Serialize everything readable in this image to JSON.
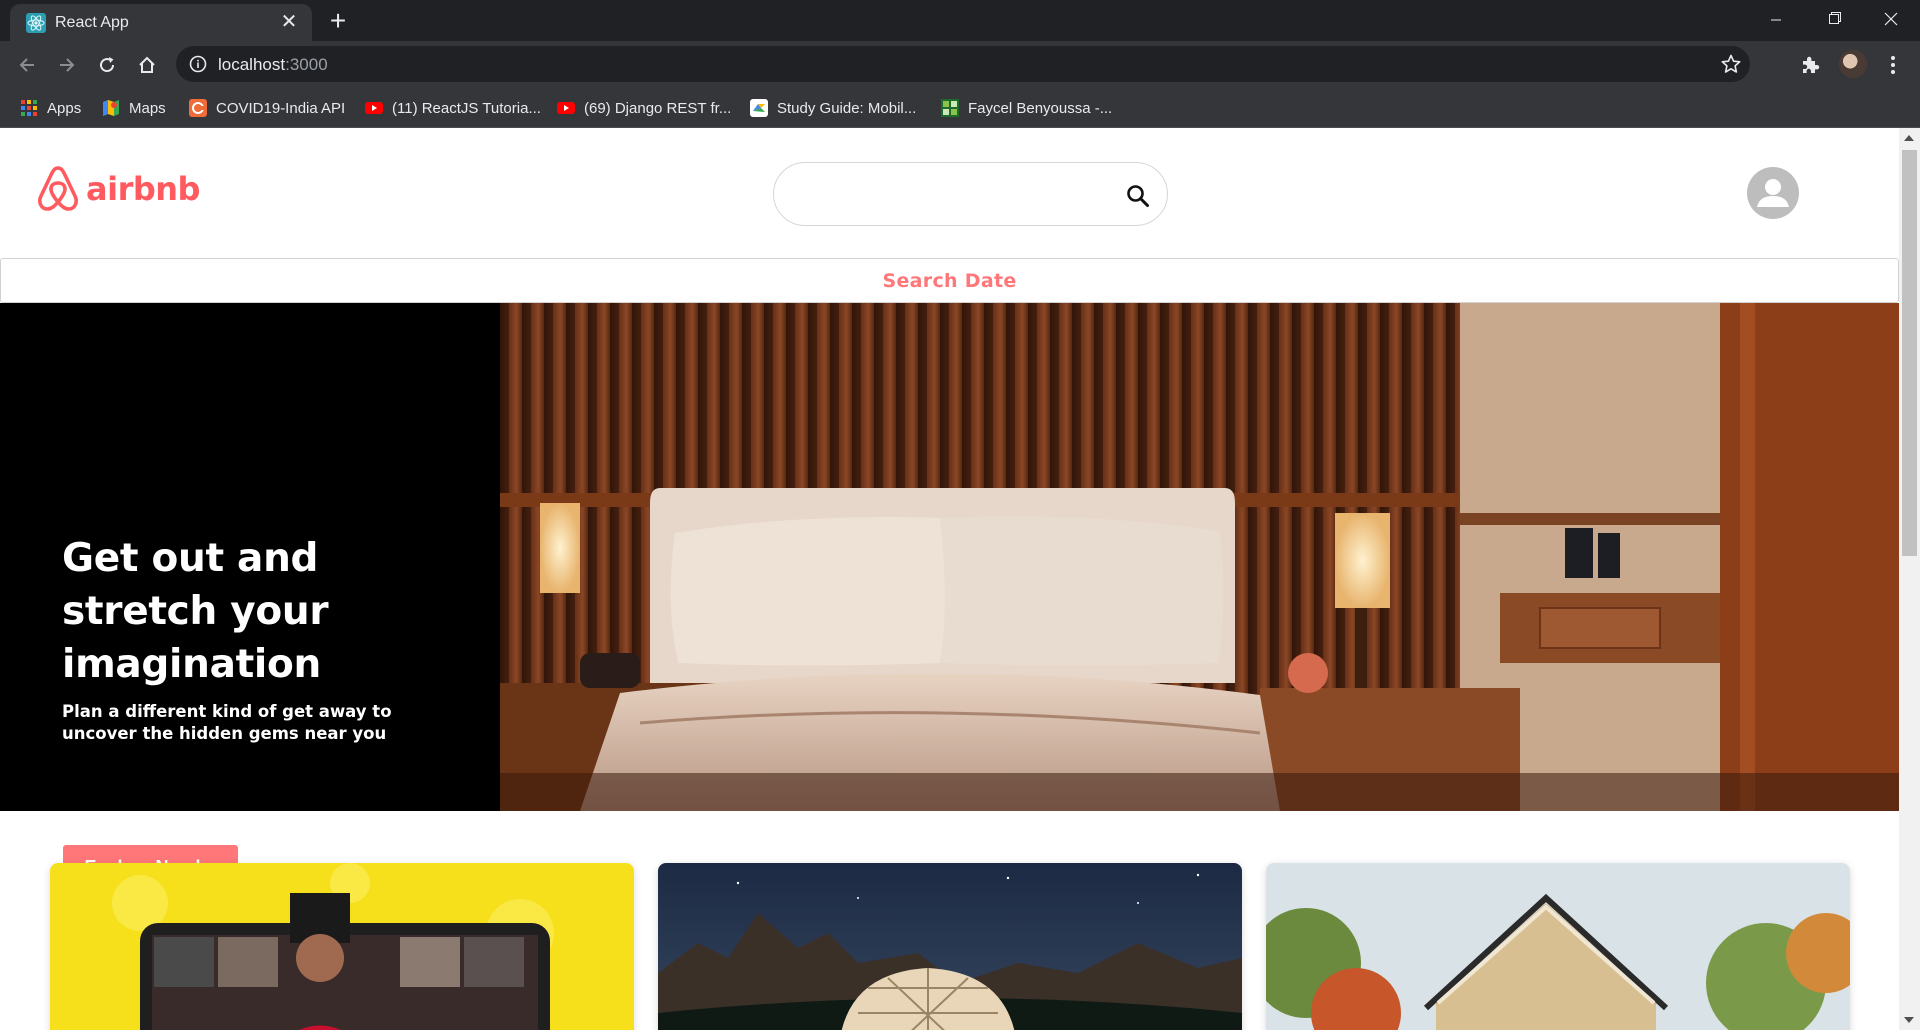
{
  "browser": {
    "tab_title": "React App",
    "url_host": "localhost",
    "url_port": ":3000",
    "bookmarks": [
      {
        "label": "Apps",
        "icon": "apps-grid-icon"
      },
      {
        "label": "Maps",
        "icon": "maps-icon"
      },
      {
        "label": "COVID19-India API",
        "icon": "covid-api-icon"
      },
      {
        "label": "(11) ReactJS Tutoria...",
        "icon": "youtube-icon"
      },
      {
        "label": "(69) Django REST fr...",
        "icon": "youtube-icon"
      },
      {
        "label": "Study Guide: Mobil...",
        "icon": "study-guide-icon"
      },
      {
        "label": "Faycel Benyoussa -...",
        "icon": "profile-site-icon"
      }
    ]
  },
  "header": {
    "logo_text": "airbnb",
    "search_placeholder": "",
    "search_value": ""
  },
  "date_bar": {
    "label": "Search Date"
  },
  "banner": {
    "title": "Get out and stretch your imagination",
    "subtitle": "Plan a different kind of get away to uncover the hidden gems near you",
    "button_label": "Explore Nearby"
  },
  "colors": {
    "brand": "#ff5a5f",
    "accent": "#ff7779"
  }
}
